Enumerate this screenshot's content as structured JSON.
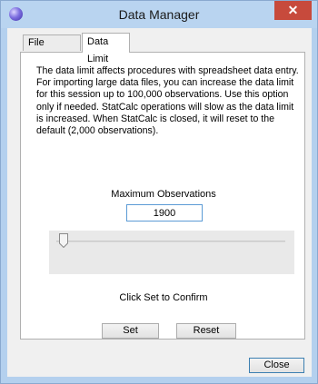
{
  "window": {
    "title": "Data Manager",
    "close_glyph": "✕",
    "app_icon": "statcalc-orb-icon"
  },
  "tabs": [
    {
      "label": "File Manager",
      "active": false
    },
    {
      "label": "Data Limit",
      "active": true
    }
  ],
  "panel": {
    "description": "The data limit affects procedures with spreadsheet data entry. For importing large data files, you can increase the data limit for this session up  to 100,000 observations.  Use this option only if needed.  StatCalc operations will slow as the data limit is increased.  When StatCalc is closed, it will reset to the default (2,000 observations).",
    "max_obs_label": "Maximum Observations",
    "max_obs_value": "1900",
    "slider_fraction": 0.0,
    "confirm_text": "Click Set to Confirm"
  },
  "buttons": {
    "set": "Set",
    "reset": "Reset",
    "close": "Close"
  },
  "colors": {
    "title_bar": "#b9d4f0",
    "close_button": "#c74a3c",
    "focus_border": "#5b9bd5"
  }
}
